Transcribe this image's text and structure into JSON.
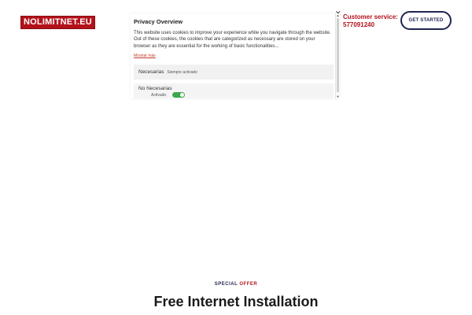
{
  "header": {
    "logo_text": "NOLIMITNET.EU",
    "support_label": "Customer service:",
    "support_phone": "577091240",
    "cta_label": "GET STARTED"
  },
  "cookie_modal": {
    "title": "Privacy Overview",
    "body": "This website uses cookies to improve your experience while you navigate through the website. Out of these cookies, the cookies that are categorized as necessary are stored on your browser as they are essential for the working of basic functionalities...",
    "show_more": "Mostrar más",
    "close_symbol": "✕",
    "categories": [
      {
        "label": "Necesarias",
        "status": "Siempre activado"
      },
      {
        "label": "No Necesarias",
        "toggle_label": "Activado",
        "enabled": true
      }
    ]
  },
  "section": {
    "offer_part1": "SPECIAL",
    "offer_part2": "OFFER",
    "headline": "Free Internet Installation"
  },
  "colors": {
    "brand_red": "#b3121b",
    "navy": "#1f2450",
    "toggle_on": "#3aa84b"
  }
}
